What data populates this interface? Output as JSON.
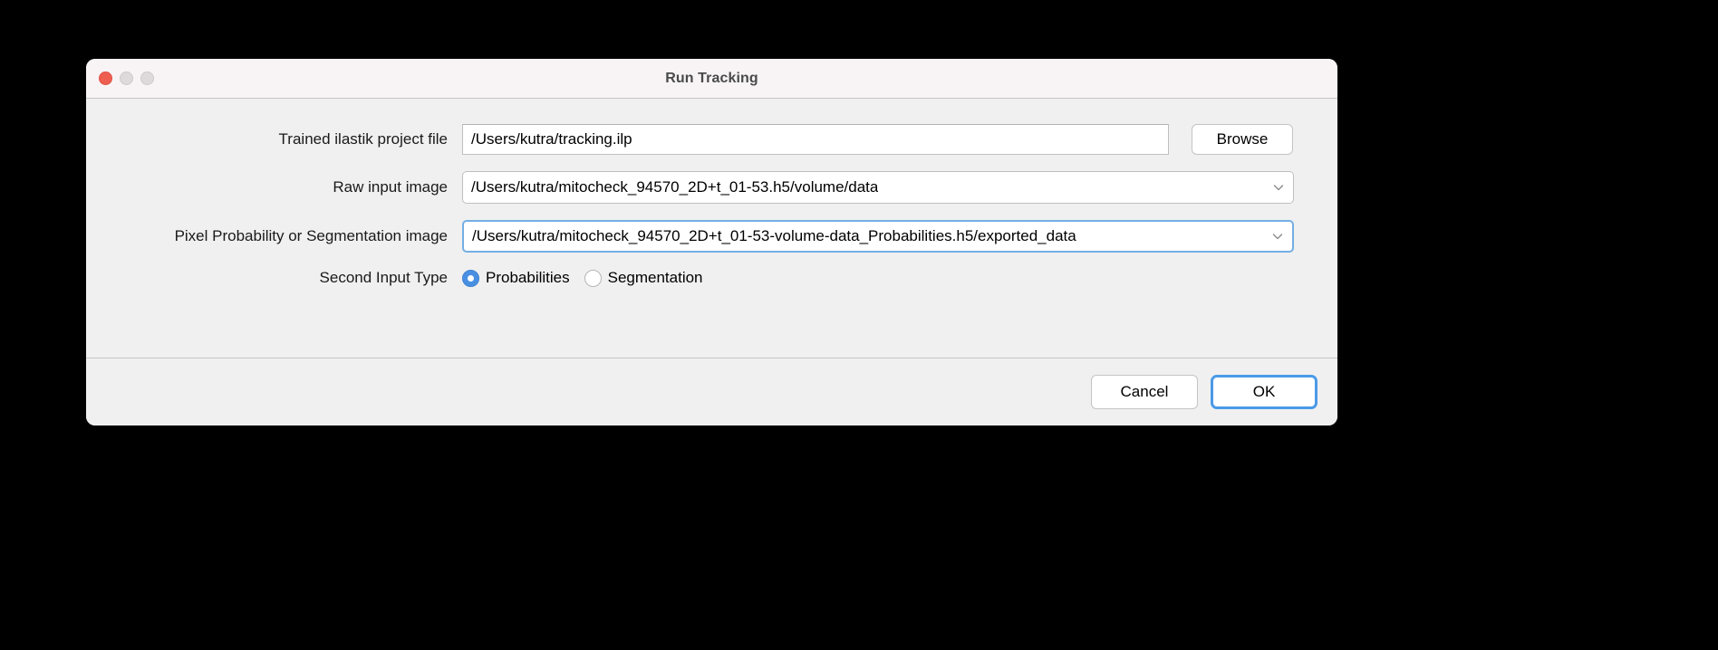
{
  "window": {
    "title": "Run Tracking",
    "traffic_lights": [
      {
        "name": "close",
        "color": "#ee5f52"
      },
      {
        "name": "minimize",
        "color": "#dedadc"
      },
      {
        "name": "maximize",
        "color": "#dedadc"
      }
    ]
  },
  "form": {
    "project_file": {
      "label": "Trained ilastik project file",
      "value": "/Users/kutra/tracking.ilp",
      "browse_label": "Browse"
    },
    "raw_input": {
      "label": "Raw input image",
      "value": "/Users/kutra/mitocheck_94570_2D+t_01-53.h5/volume/data",
      "icon": "chevron-down-icon"
    },
    "probability_input": {
      "label": "Pixel Probability or Segmentation image",
      "value": "/Users/kutra/mitocheck_94570_2D+t_01-53-volume-data_Probabilities.h5/exported_data",
      "icon": "chevron-down-icon",
      "focused": true
    },
    "second_input_type": {
      "label": "Second Input Type",
      "options": [
        {
          "label": "Probabilities",
          "selected": true
        },
        {
          "label": "Segmentation",
          "selected": false
        }
      ]
    }
  },
  "footer": {
    "cancel_label": "Cancel",
    "ok_label": "OK"
  },
  "colors": {
    "accent": "#4a90e2",
    "focus_ring": "#4a9ae8",
    "titlebar_bg": "#f8f4f6",
    "body_bg": "#f0f0f0",
    "close_button": "#ee5f52"
  }
}
